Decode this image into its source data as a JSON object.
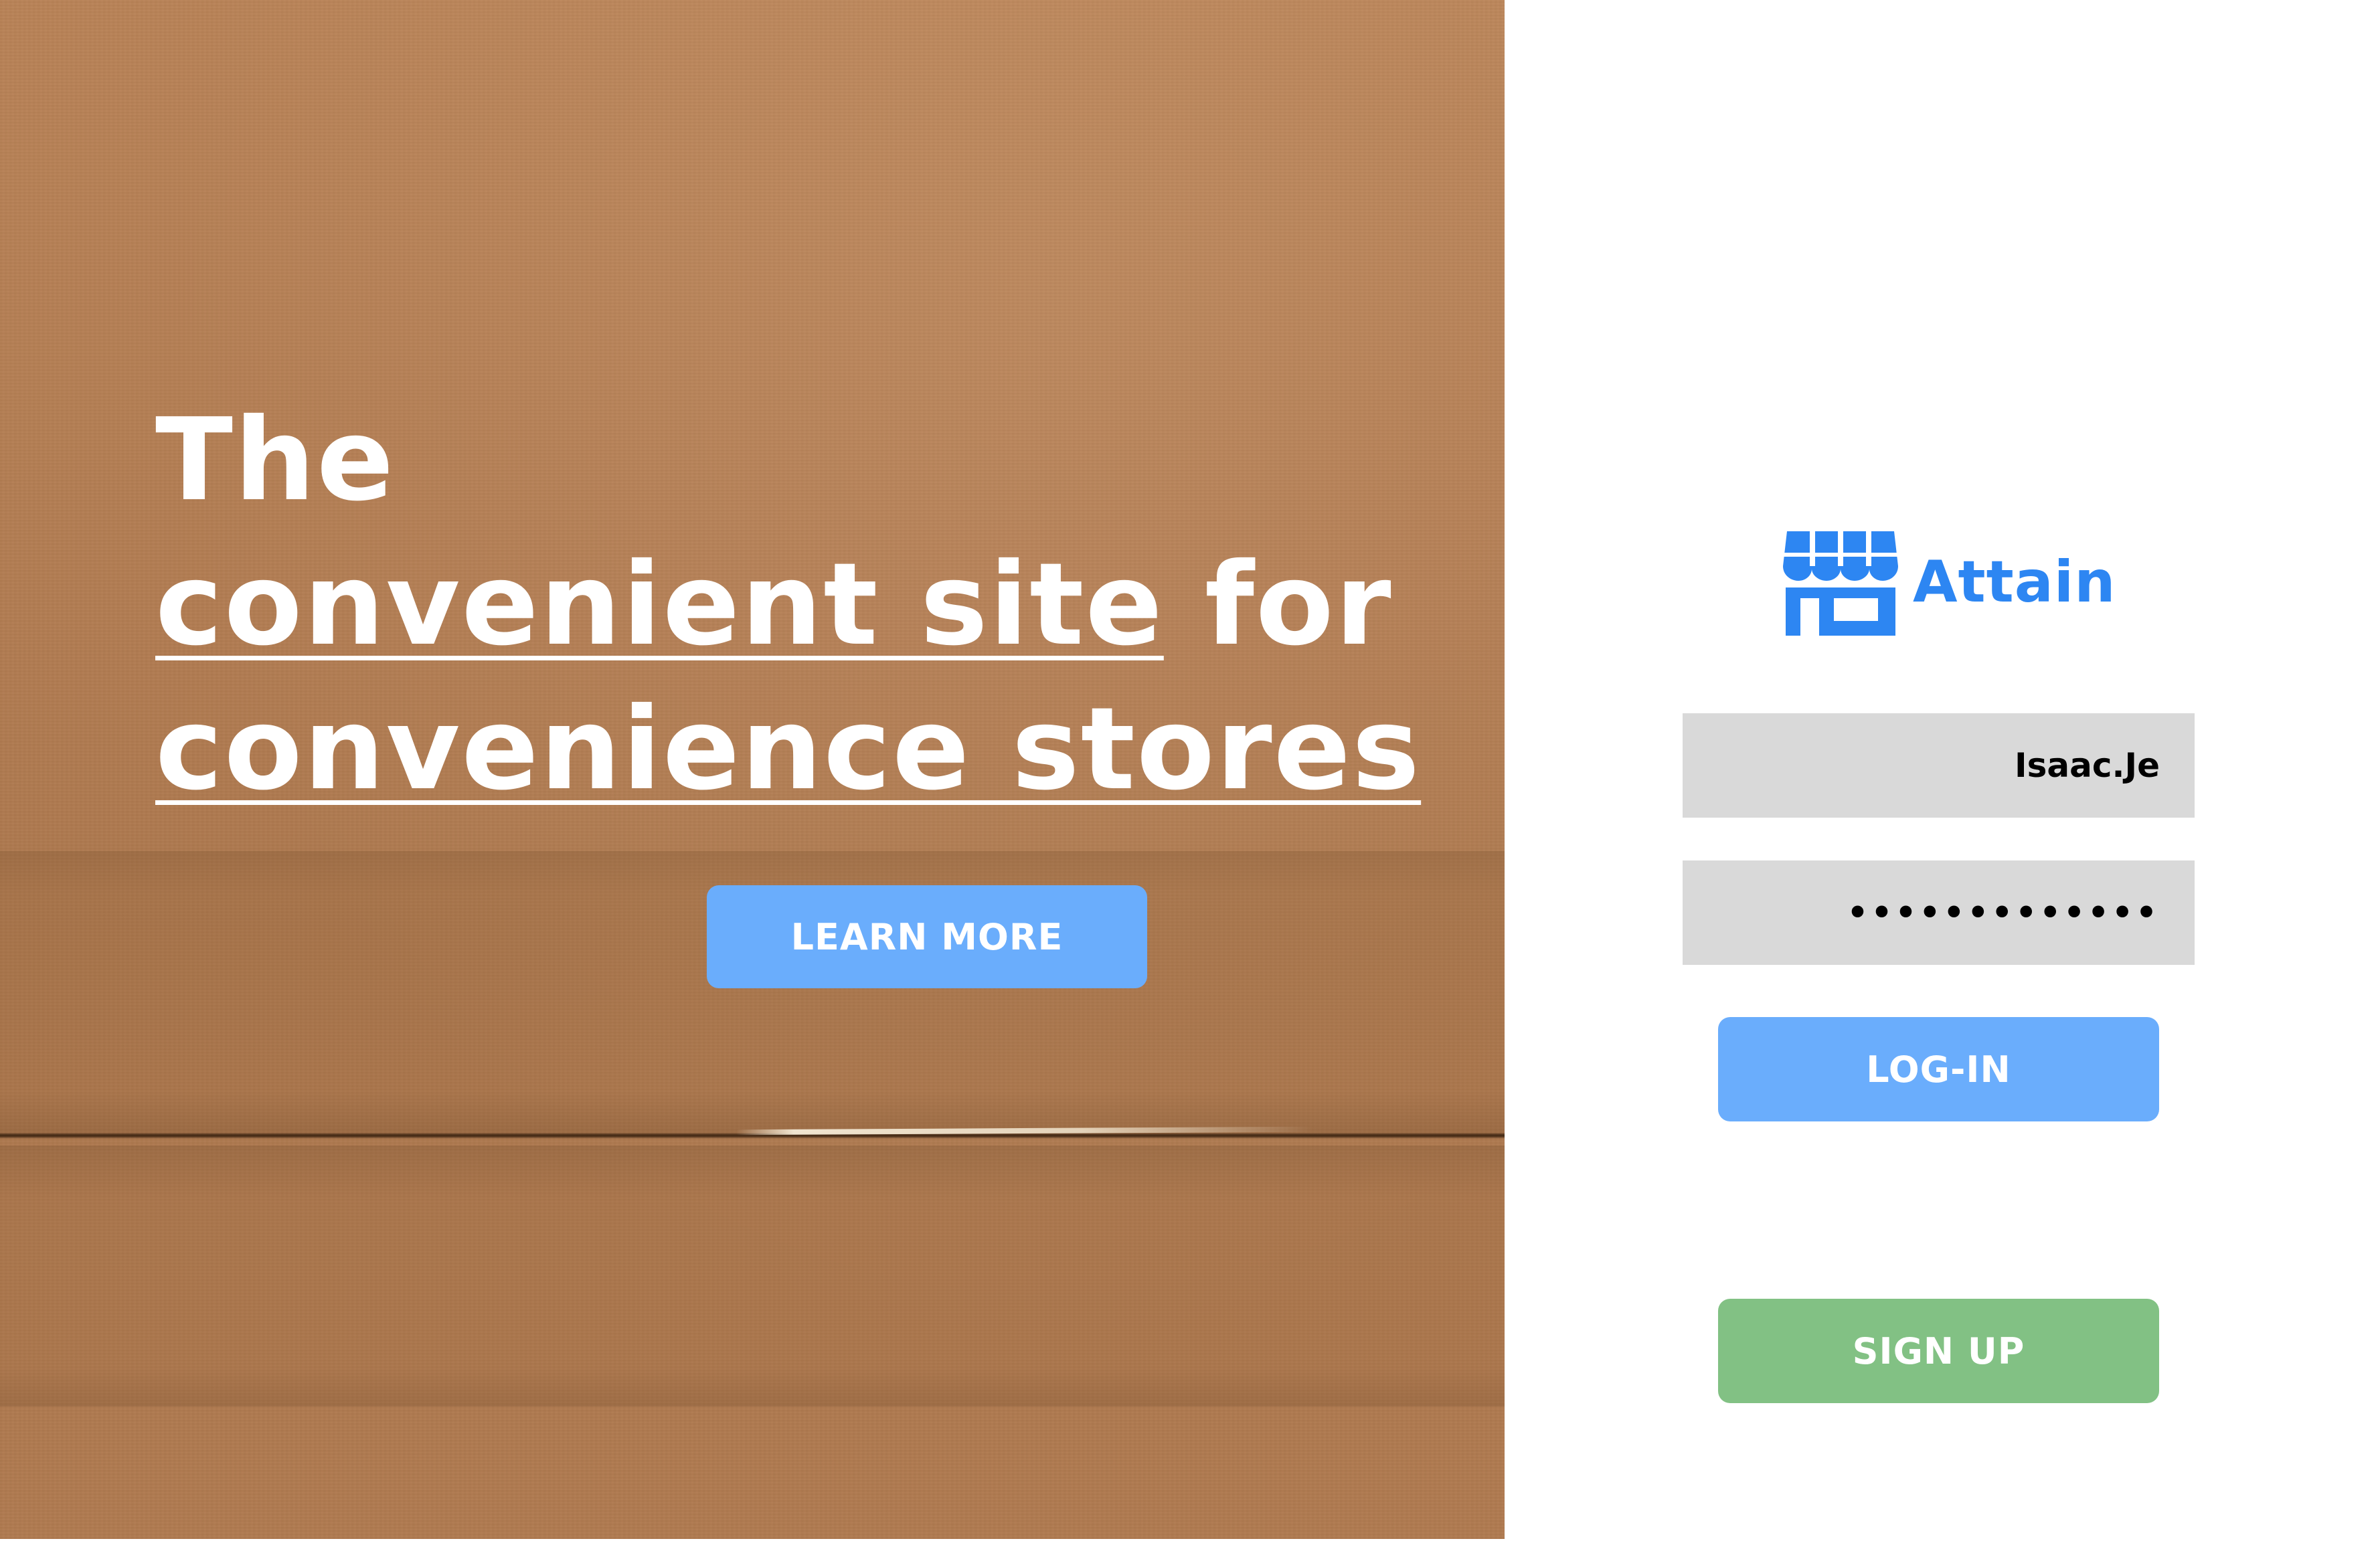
{
  "hero": {
    "headline_line1": "The",
    "headline_line2_underlined": "convenient site",
    "headline_line2_rest": " for",
    "headline_line3_underlined": "convenience stores",
    "learn_more_label": "LEARN MORE"
  },
  "brand": {
    "name": "Attain",
    "icon": "storefront-icon",
    "color": "#2d86f2"
  },
  "login": {
    "username_value": "Isaac.Je",
    "password_value": "•••••••••••••",
    "login_label": "LOG-IN",
    "signup_label": "SIGN UP"
  },
  "colors": {
    "primary_button": "#6aadfc",
    "signup_button": "#82c184",
    "field_background": "#d9d9d9",
    "cardboard": "#b47e55"
  }
}
